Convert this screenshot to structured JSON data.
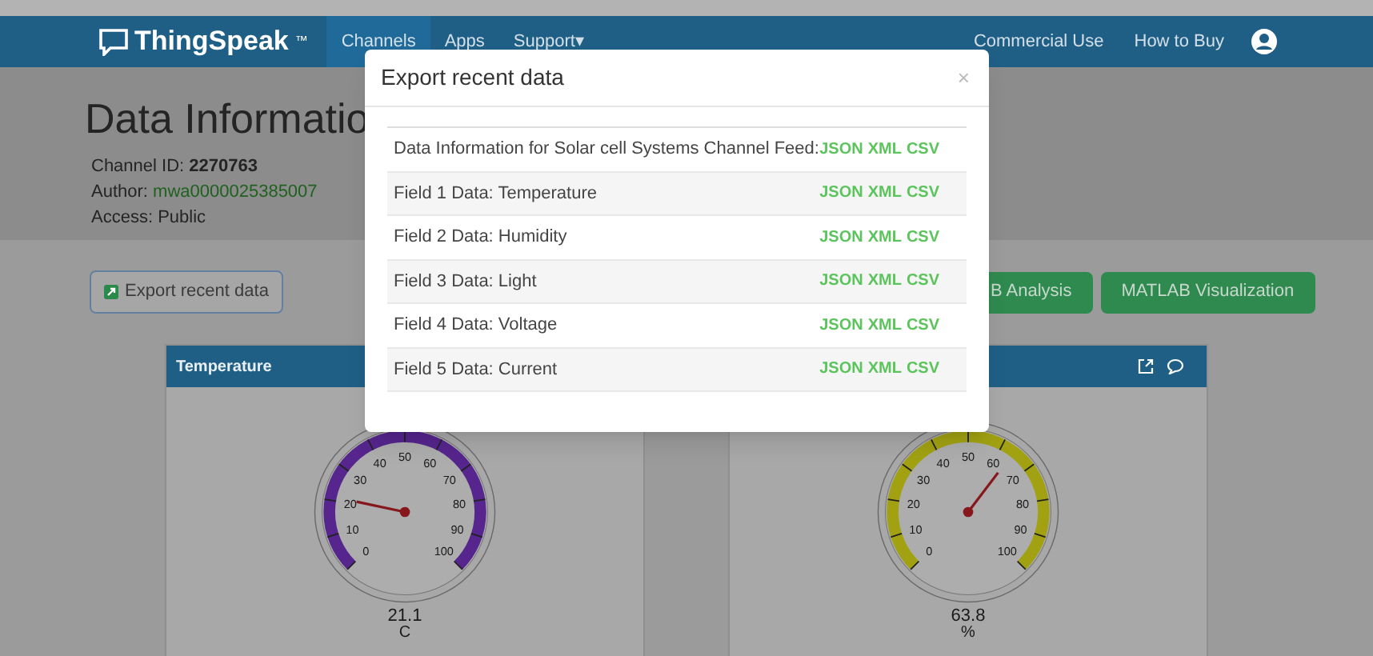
{
  "nav": {
    "brand": "ThingSpeak",
    "trademark": "™",
    "items": [
      {
        "label": "Channels",
        "selected": true
      },
      {
        "label": "Apps",
        "selected": false
      },
      {
        "label": "Support",
        "selected": false,
        "caret": "▾"
      }
    ],
    "right_items": [
      "Commercial Use",
      "How to Buy"
    ]
  },
  "channel": {
    "title": "Data Informatio",
    "details": [
      {
        "label": "Channel ID: ",
        "value": "2270763",
        "kind": "bold"
      },
      {
        "label": "Author: ",
        "value": "mwa0000025385007",
        "kind": "link"
      },
      {
        "label": "Access: ",
        "value": "Public",
        "kind": "plain"
      }
    ]
  },
  "actions": [
    {
      "label": "Export recent data",
      "kind": "outline"
    },
    {
      "label": "B Analysis",
      "kind": "green"
    },
    {
      "label": "MATLAB Visualization",
      "kind": "green"
    }
  ],
  "cards": [
    {
      "title": "Temperature",
      "color": "#56258d",
      "value": "21.1",
      "unit": "C",
      "ticks": [
        "0",
        "10",
        "20",
        "30",
        "40",
        "50",
        "60",
        "70",
        "80",
        "90",
        "100"
      ]
    },
    {
      "color": "#a1a112",
      "value": "63.8",
      "unit": "%",
      "ticks": [
        "0",
        "10",
        "20",
        "30",
        "40",
        "50",
        "60",
        "70",
        "80",
        "90",
        "100"
      ]
    }
  ],
  "modal": {
    "title": "Export recent data",
    "close": "×",
    "rows": [
      {
        "label": "Data Information for Solar cell Systems Channel Feed:",
        "formats": [
          "JSON",
          "XML",
          "CSV"
        ]
      },
      {
        "label": "Field 1 Data: Temperature",
        "formats": [
          "JSON",
          "XML",
          "CSV"
        ]
      },
      {
        "label": "Field 2 Data: Humidity",
        "formats": [
          "JSON",
          "XML",
          "CSV"
        ]
      },
      {
        "label": "Field 3 Data: Light",
        "formats": [
          "JSON",
          "XML",
          "CSV"
        ]
      },
      {
        "label": "Field 4 Data: Voltage",
        "formats": [
          "JSON",
          "XML",
          "CSV"
        ]
      },
      {
        "label": "Field 5 Data: Current",
        "formats": [
          "JSON",
          "XML",
          "CSV"
        ]
      }
    ]
  }
}
